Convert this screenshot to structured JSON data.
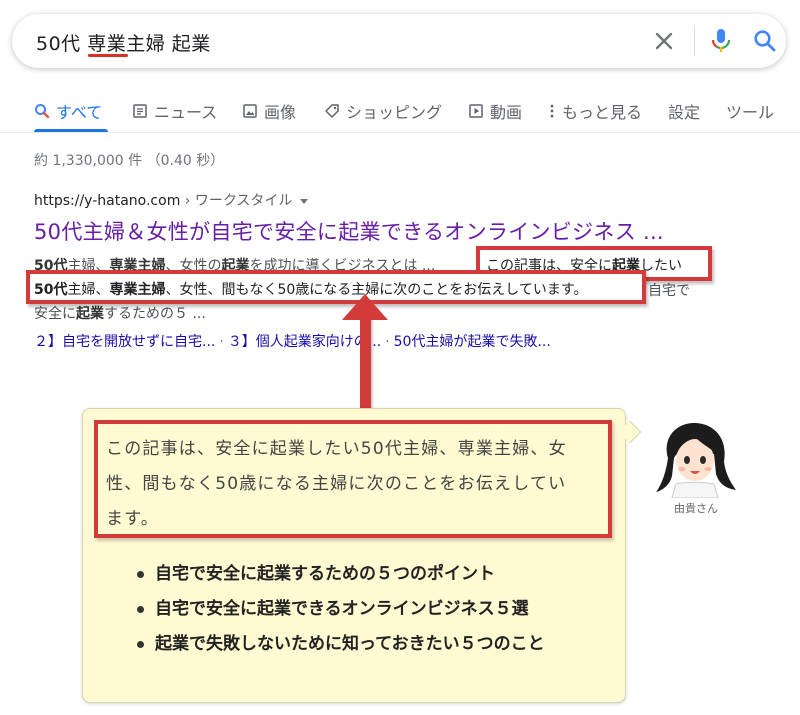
{
  "search": {
    "query": "50代 専業主婦 起業"
  },
  "tabs": [
    {
      "label": "すべて",
      "icon": "search-icon",
      "active": true
    },
    {
      "label": "ニュース",
      "icon": "news-icon"
    },
    {
      "label": "画像",
      "icon": "image-icon"
    },
    {
      "label": "ショッピング",
      "icon": "tag-icon"
    },
    {
      "label": "動画",
      "icon": "video-icon"
    },
    {
      "label": "もっと見る",
      "icon": "more-vert-icon"
    },
    {
      "label": "設定"
    },
    {
      "label": "ツール"
    }
  ],
  "result_stats": "約 1,330,000 件 （0.40 秒）",
  "result": {
    "url_domain": "https://y-hatano.com",
    "url_crumb": " › ワークスタイル",
    "title": "50代主婦＆女性が自宅で安全に起業できるオンラインビジネス ...",
    "snippet_line1_bold_a": "50代",
    "snippet_line1_a": "主婦、",
    "snippet_line1_bold_b": "専業主婦",
    "snippet_line1_b": "、女性の",
    "snippet_line1_bold_c": "起業",
    "snippet_line1_c": "を成功に導くビジネスとは ...",
    "highlight1_a": "この記事は、安全に",
    "highlight1_bold": "起業",
    "highlight1_b": "したい",
    "highlight2_bold_a": "50代",
    "highlight2_a": "主婦、",
    "highlight2_bold_b": "専業主婦",
    "highlight2_b": "、女性、間もなく50歳になる主婦に次のことをお伝えしています。",
    "snippet_line2_tail": "自宅で",
    "snippet_line3_a": "安全に",
    "snippet_line3_bold": "起業",
    "snippet_line3_b": "するための５ ...",
    "sitelinks": [
      "２】自宅を開放せずに自宅...",
      "３】個人起業家向けの...",
      "50代主婦が起業で失敗..."
    ]
  },
  "bubble": {
    "quote_lines": [
      "この記事は、安全に起業したい50代主婦、専業主婦、女",
      "性、間もなく50歳になる主婦に次のことをお伝えしてい",
      "ます。"
    ],
    "bullets": [
      "自宅で安全に起業するための５つのポイント",
      "自宅で安全に起業できるオンラインビジネス５選",
      "起業で失敗しないために知っておきたい５つのこと"
    ],
    "avatar_name": "由貴さん"
  },
  "colors": {
    "accent_blue": "#1a73e8",
    "visited_title": "#681da8",
    "link_blue": "#1a0dab",
    "highlight_red": "#d33b3b",
    "bubble_bg": "#fffad2"
  }
}
